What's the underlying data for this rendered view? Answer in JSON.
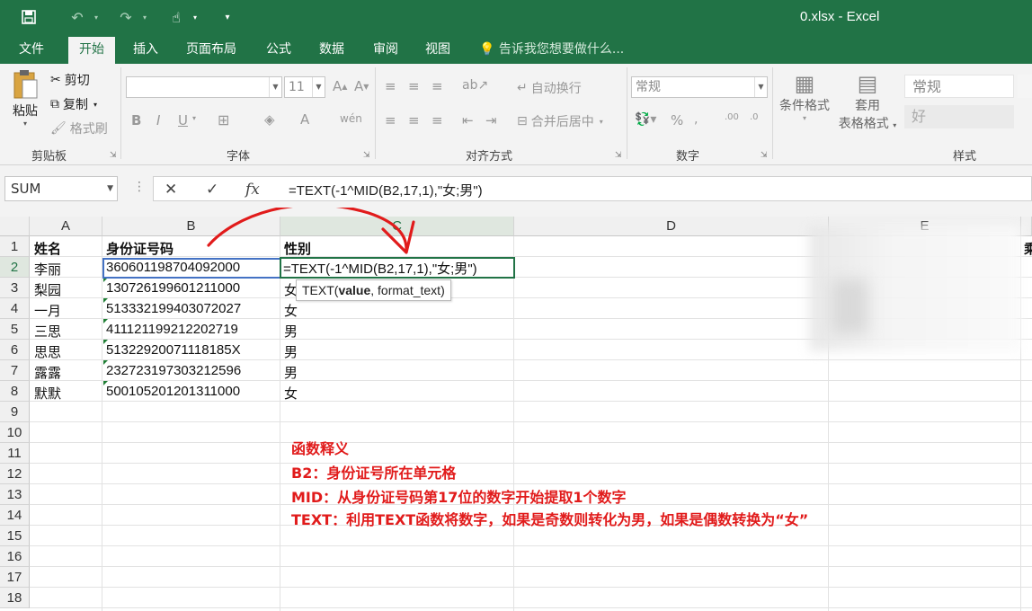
{
  "window": {
    "title": "0.xlsx - Excel"
  },
  "tabs": [
    {
      "label": "文件"
    },
    {
      "label": "开始"
    },
    {
      "label": "插入"
    },
    {
      "label": "页面布局"
    },
    {
      "label": "公式"
    },
    {
      "label": "数据"
    },
    {
      "label": "审阅"
    },
    {
      "label": "视图"
    }
  ],
  "tell_me": "告诉我您想要做什么...",
  "ribbon": {
    "clipboard": {
      "paste": "粘贴",
      "cut": "剪切",
      "copy": "复制",
      "format_painter": "格式刷",
      "label": "剪贴板"
    },
    "font": {
      "size": "11",
      "label": "字体"
    },
    "alignment": {
      "wrap": "自动换行",
      "merge": "合并后居中",
      "label": "对齐方式"
    },
    "number": {
      "format": "常规",
      "label": "数字"
    },
    "styles": {
      "cond_format": "条件格式",
      "table_format_1": "套用",
      "table_format_2": "表格格式",
      "style_normal": "常规",
      "style_good": "好",
      "label": "样式"
    }
  },
  "formula_bar": {
    "name_box": "SUM",
    "fx": "fx",
    "formula": "=TEXT(-1^MID(B2,17,1),\"女;男\")"
  },
  "columns": [
    "A",
    "B",
    "C",
    "D",
    "E"
  ],
  "rows": [
    "1",
    "2",
    "3",
    "4",
    "5",
    "6",
    "7",
    "8",
    "9",
    "10",
    "11",
    "12",
    "13",
    "14",
    "15",
    "16",
    "17",
    "18"
  ],
  "sheet": {
    "headers": {
      "a": "姓名",
      "b": "身份证号码",
      "c": "性别",
      "partial": "乘"
    },
    "records": [
      {
        "name": "李丽",
        "id": "360601198704092000",
        "gender": ""
      },
      {
        "name": "梨园",
        "id": "130726199601211000",
        "gender": "女"
      },
      {
        "name": "一月",
        "id": "513332199403072027",
        "gender": "女"
      },
      {
        "name": "三思",
        "id": "411121199212202719",
        "gender": "男"
      },
      {
        "name": "思思",
        "id": "51322920071118185X",
        "gender": "男"
      },
      {
        "name": "露露",
        "id": "232723197303212596",
        "gender": "男"
      },
      {
        "name": "默默",
        "id": "500105201201311000",
        "gender": "女"
      }
    ],
    "active_cell_text": "=TEXT(-1^MID(B2,17,1),\"女;男\")",
    "tooltip": {
      "fn": "TEXT(",
      "arg1": "value",
      "rest": ", format_text)"
    }
  },
  "notes": [
    "函数释义",
    "B2：身份证号所在单元格",
    "MID：从身份证号码第17位的数字开始提取1个数字",
    "TEXT：利用TEXT函数将数字，如果是奇数则转化为男，如果是偶数转换为“女”"
  ],
  "colors": {
    "excel_green": "#217346",
    "annotation_red": "#e11b1b",
    "select_blue": "#4472c4"
  }
}
